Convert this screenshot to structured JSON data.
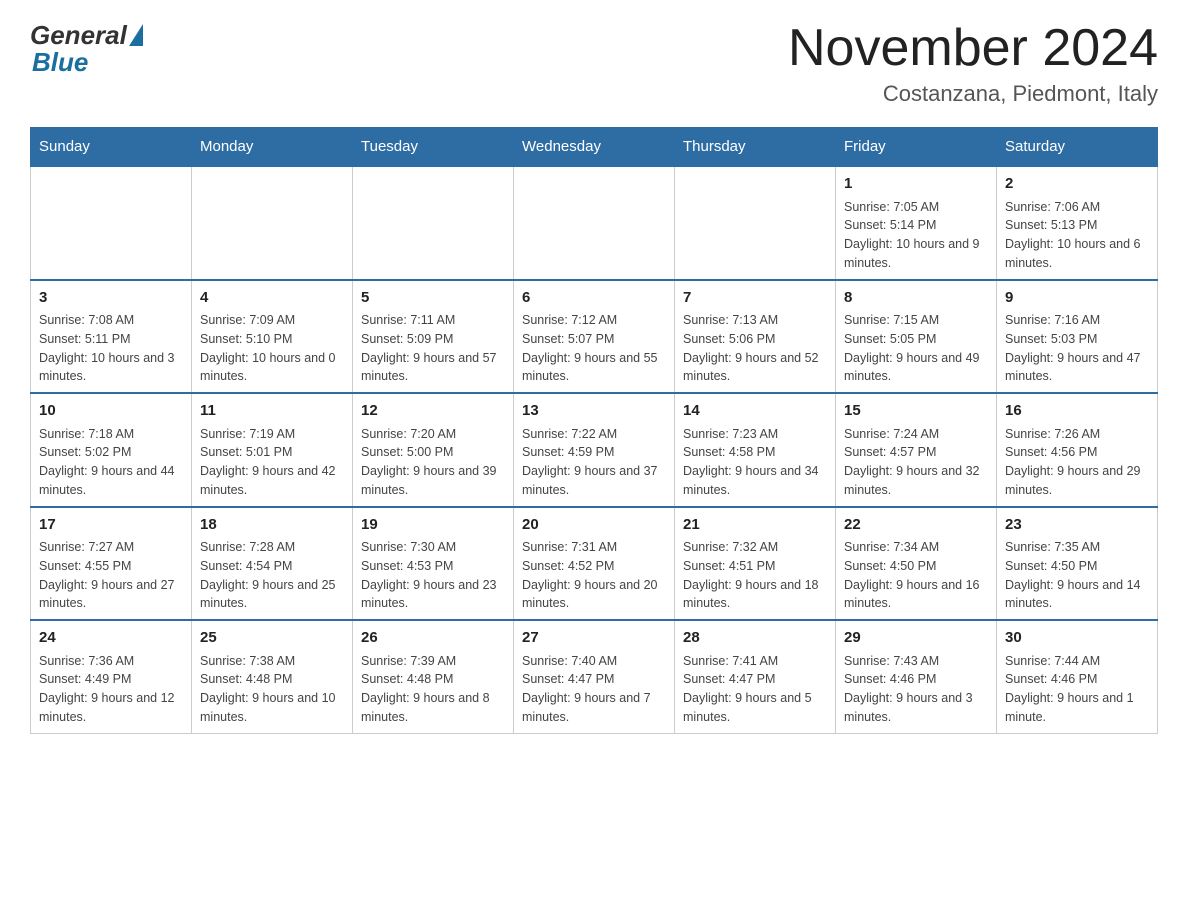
{
  "header": {
    "logo_general": "General",
    "logo_blue": "Blue",
    "month_title": "November 2024",
    "location": "Costanzana, Piedmont, Italy"
  },
  "days_of_week": [
    "Sunday",
    "Monday",
    "Tuesday",
    "Wednesday",
    "Thursday",
    "Friday",
    "Saturday"
  ],
  "weeks": [
    [
      {
        "day": "",
        "info": ""
      },
      {
        "day": "",
        "info": ""
      },
      {
        "day": "",
        "info": ""
      },
      {
        "day": "",
        "info": ""
      },
      {
        "day": "",
        "info": ""
      },
      {
        "day": "1",
        "info": "Sunrise: 7:05 AM\nSunset: 5:14 PM\nDaylight: 10 hours and 9 minutes."
      },
      {
        "day": "2",
        "info": "Sunrise: 7:06 AM\nSunset: 5:13 PM\nDaylight: 10 hours and 6 minutes."
      }
    ],
    [
      {
        "day": "3",
        "info": "Sunrise: 7:08 AM\nSunset: 5:11 PM\nDaylight: 10 hours and 3 minutes."
      },
      {
        "day": "4",
        "info": "Sunrise: 7:09 AM\nSunset: 5:10 PM\nDaylight: 10 hours and 0 minutes."
      },
      {
        "day": "5",
        "info": "Sunrise: 7:11 AM\nSunset: 5:09 PM\nDaylight: 9 hours and 57 minutes."
      },
      {
        "day": "6",
        "info": "Sunrise: 7:12 AM\nSunset: 5:07 PM\nDaylight: 9 hours and 55 minutes."
      },
      {
        "day": "7",
        "info": "Sunrise: 7:13 AM\nSunset: 5:06 PM\nDaylight: 9 hours and 52 minutes."
      },
      {
        "day": "8",
        "info": "Sunrise: 7:15 AM\nSunset: 5:05 PM\nDaylight: 9 hours and 49 minutes."
      },
      {
        "day": "9",
        "info": "Sunrise: 7:16 AM\nSunset: 5:03 PM\nDaylight: 9 hours and 47 minutes."
      }
    ],
    [
      {
        "day": "10",
        "info": "Sunrise: 7:18 AM\nSunset: 5:02 PM\nDaylight: 9 hours and 44 minutes."
      },
      {
        "day": "11",
        "info": "Sunrise: 7:19 AM\nSunset: 5:01 PM\nDaylight: 9 hours and 42 minutes."
      },
      {
        "day": "12",
        "info": "Sunrise: 7:20 AM\nSunset: 5:00 PM\nDaylight: 9 hours and 39 minutes."
      },
      {
        "day": "13",
        "info": "Sunrise: 7:22 AM\nSunset: 4:59 PM\nDaylight: 9 hours and 37 minutes."
      },
      {
        "day": "14",
        "info": "Sunrise: 7:23 AM\nSunset: 4:58 PM\nDaylight: 9 hours and 34 minutes."
      },
      {
        "day": "15",
        "info": "Sunrise: 7:24 AM\nSunset: 4:57 PM\nDaylight: 9 hours and 32 minutes."
      },
      {
        "day": "16",
        "info": "Sunrise: 7:26 AM\nSunset: 4:56 PM\nDaylight: 9 hours and 29 minutes."
      }
    ],
    [
      {
        "day": "17",
        "info": "Sunrise: 7:27 AM\nSunset: 4:55 PM\nDaylight: 9 hours and 27 minutes."
      },
      {
        "day": "18",
        "info": "Sunrise: 7:28 AM\nSunset: 4:54 PM\nDaylight: 9 hours and 25 minutes."
      },
      {
        "day": "19",
        "info": "Sunrise: 7:30 AM\nSunset: 4:53 PM\nDaylight: 9 hours and 23 minutes."
      },
      {
        "day": "20",
        "info": "Sunrise: 7:31 AM\nSunset: 4:52 PM\nDaylight: 9 hours and 20 minutes."
      },
      {
        "day": "21",
        "info": "Sunrise: 7:32 AM\nSunset: 4:51 PM\nDaylight: 9 hours and 18 minutes."
      },
      {
        "day": "22",
        "info": "Sunrise: 7:34 AM\nSunset: 4:50 PM\nDaylight: 9 hours and 16 minutes."
      },
      {
        "day": "23",
        "info": "Sunrise: 7:35 AM\nSunset: 4:50 PM\nDaylight: 9 hours and 14 minutes."
      }
    ],
    [
      {
        "day": "24",
        "info": "Sunrise: 7:36 AM\nSunset: 4:49 PM\nDaylight: 9 hours and 12 minutes."
      },
      {
        "day": "25",
        "info": "Sunrise: 7:38 AM\nSunset: 4:48 PM\nDaylight: 9 hours and 10 minutes."
      },
      {
        "day": "26",
        "info": "Sunrise: 7:39 AM\nSunset: 4:48 PM\nDaylight: 9 hours and 8 minutes."
      },
      {
        "day": "27",
        "info": "Sunrise: 7:40 AM\nSunset: 4:47 PM\nDaylight: 9 hours and 7 minutes."
      },
      {
        "day": "28",
        "info": "Sunrise: 7:41 AM\nSunset: 4:47 PM\nDaylight: 9 hours and 5 minutes."
      },
      {
        "day": "29",
        "info": "Sunrise: 7:43 AM\nSunset: 4:46 PM\nDaylight: 9 hours and 3 minutes."
      },
      {
        "day": "30",
        "info": "Sunrise: 7:44 AM\nSunset: 4:46 PM\nDaylight: 9 hours and 1 minute."
      }
    ]
  ]
}
